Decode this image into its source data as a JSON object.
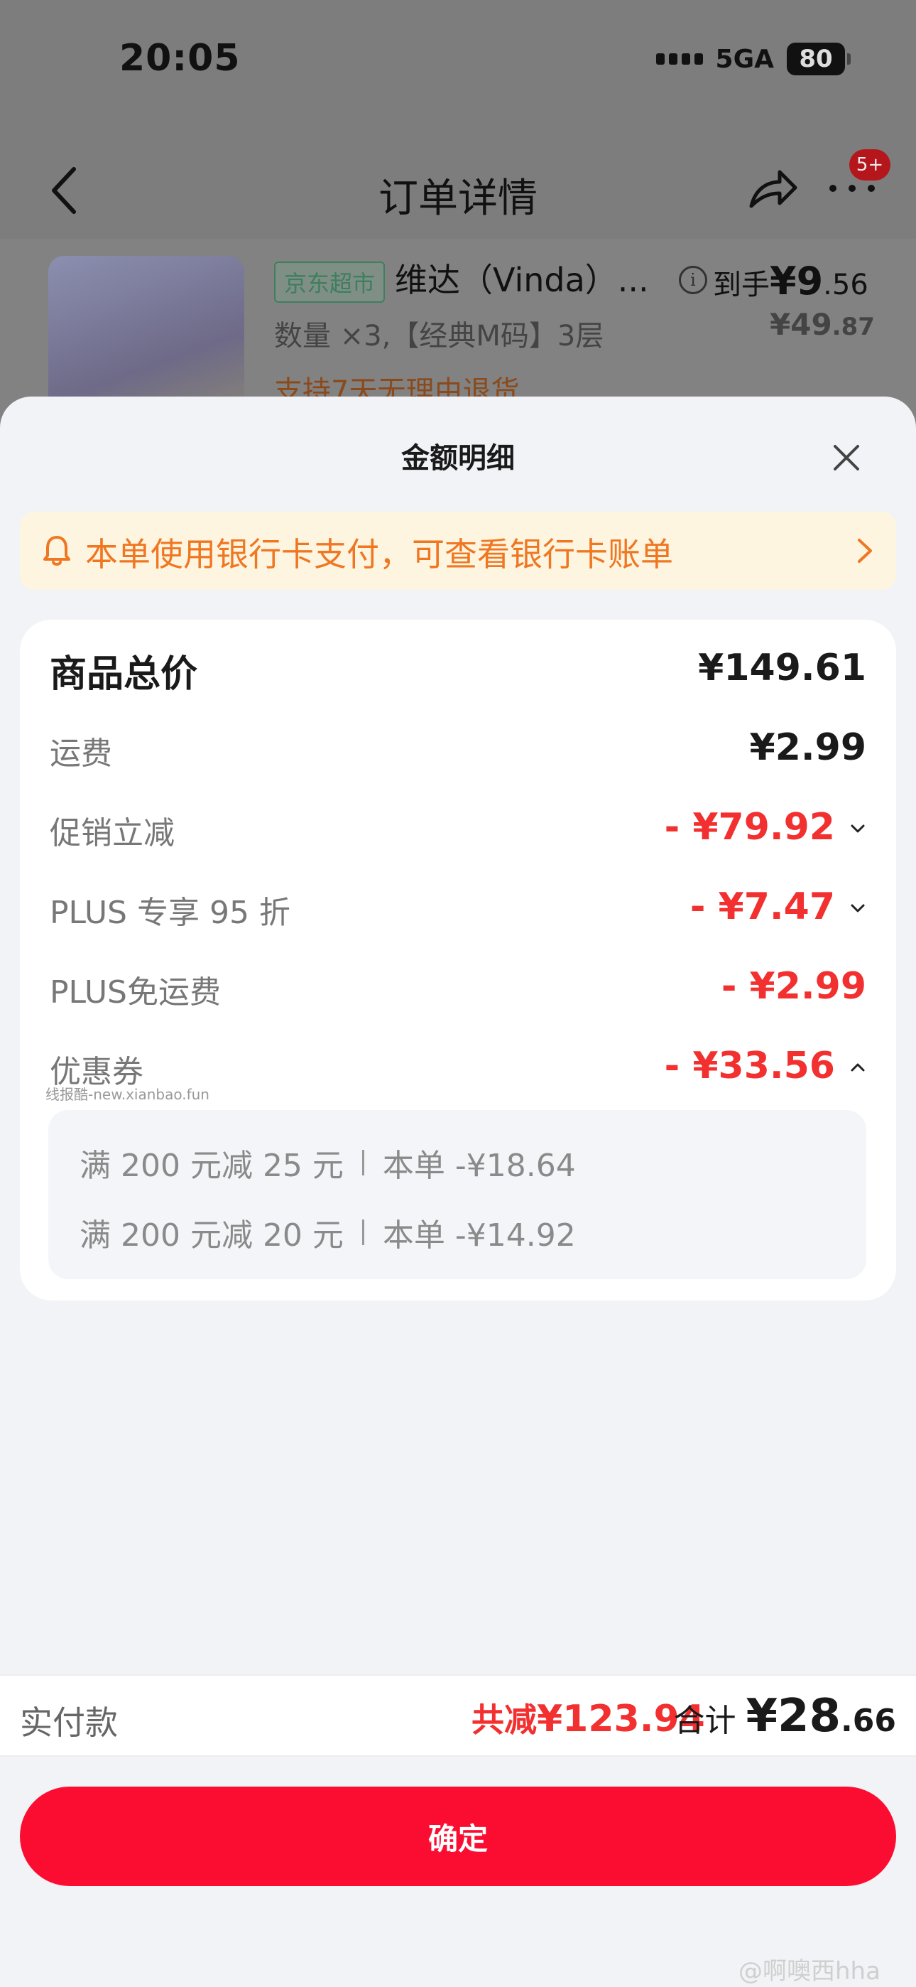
{
  "status": {
    "time": "20:05",
    "network": "5GA",
    "battery": "80"
  },
  "nav": {
    "title": "订单详情",
    "badge": "5+"
  },
  "product": {
    "store_tag": "京东超市",
    "name": "维达（Vinda）...",
    "arrive_label": "到手",
    "arrive_price_int": "¥9",
    "arrive_price_dec": ".56",
    "orig_price_int": "¥49",
    "orig_price_dec": ".87",
    "spec": "数量 ×3,【经典M码】3层",
    "return_policy": "支持7天无理由退货"
  },
  "sheet": {
    "title": "金额明细",
    "notice": "本单使用银行卡支付，可查看银行卡账单",
    "rows": [
      {
        "label": "商品总价",
        "value": "¥149.61"
      },
      {
        "label": "运费",
        "value": "¥2.99"
      },
      {
        "label": "促销立减",
        "value": "- ¥79.92"
      },
      {
        "label": "PLUS 专享 95 折",
        "value": "- ¥7.47"
      },
      {
        "label": "PLUS免运费",
        "value": "- ¥2.99"
      },
      {
        "label": "优惠券",
        "value": "- ¥33.56"
      }
    ],
    "watermark": "线报酷-new.xianbao.fun",
    "coupons": [
      {
        "rule": "满 200 元减 25 元",
        "saving": "本单 -¥18.64"
      },
      {
        "rule": "满 200 元减 20 元",
        "saving": "本单 -¥14.92"
      }
    ]
  },
  "footer": {
    "pay_label": "实付款",
    "saved_label": "共减",
    "saved_value": "¥123.94",
    "total_label": "合计",
    "total_int": "¥28",
    "total_dec": ".66",
    "confirm_label": "确定",
    "weibo_watermark": "@啊噢西hha"
  },
  "colors": {
    "accent_red": "#f2302f",
    "button_red": "#fb0d31",
    "notice_orange": "#f07722"
  }
}
